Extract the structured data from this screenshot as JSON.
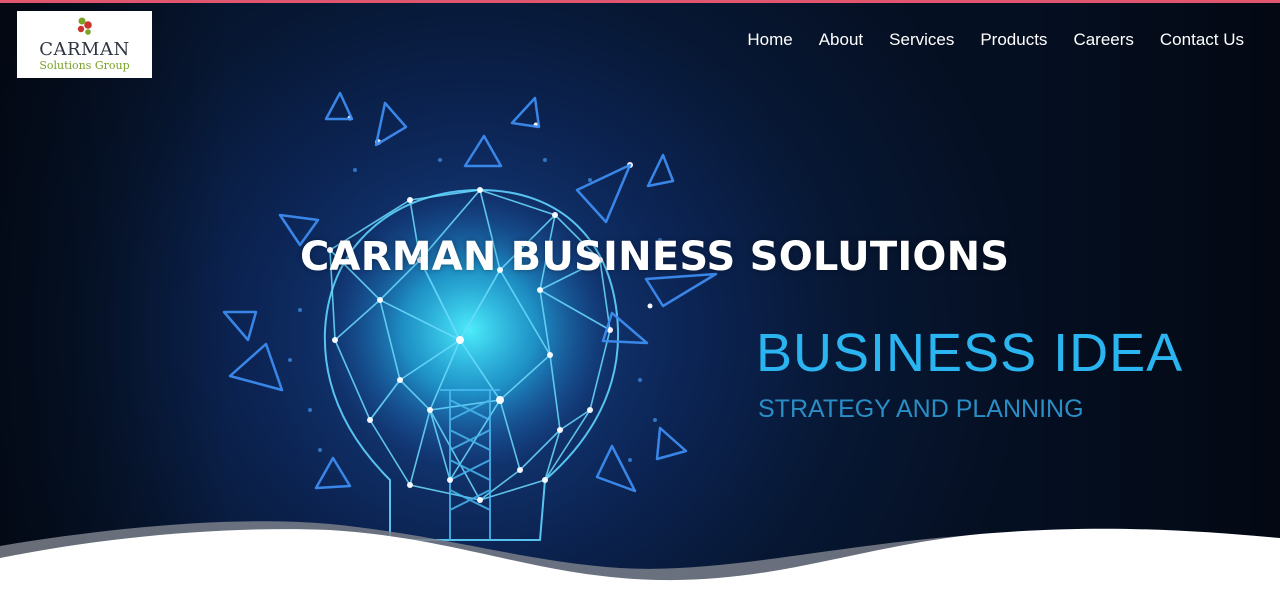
{
  "brand": {
    "logo_name": "CARMAN",
    "logo_sub": "Solutions Group"
  },
  "nav": {
    "items": [
      {
        "label": "Home"
      },
      {
        "label": "About"
      },
      {
        "label": "Services"
      },
      {
        "label": "Products"
      },
      {
        "label": "Careers"
      },
      {
        "label": "Contact Us"
      }
    ]
  },
  "hero": {
    "title": "CARMAN BUSINESS SOLUTIONS",
    "tagline": "BUSINESS IDEA",
    "subtagline": "STRATEGY AND PLANNING"
  },
  "colors": {
    "accent_bar": "#e0566f",
    "tagline": "#2ab4f0",
    "subtagline": "#2a8ec6",
    "hero_background": "#071733",
    "logo_green": "#7aa226",
    "logo_red": "#c9342d"
  }
}
